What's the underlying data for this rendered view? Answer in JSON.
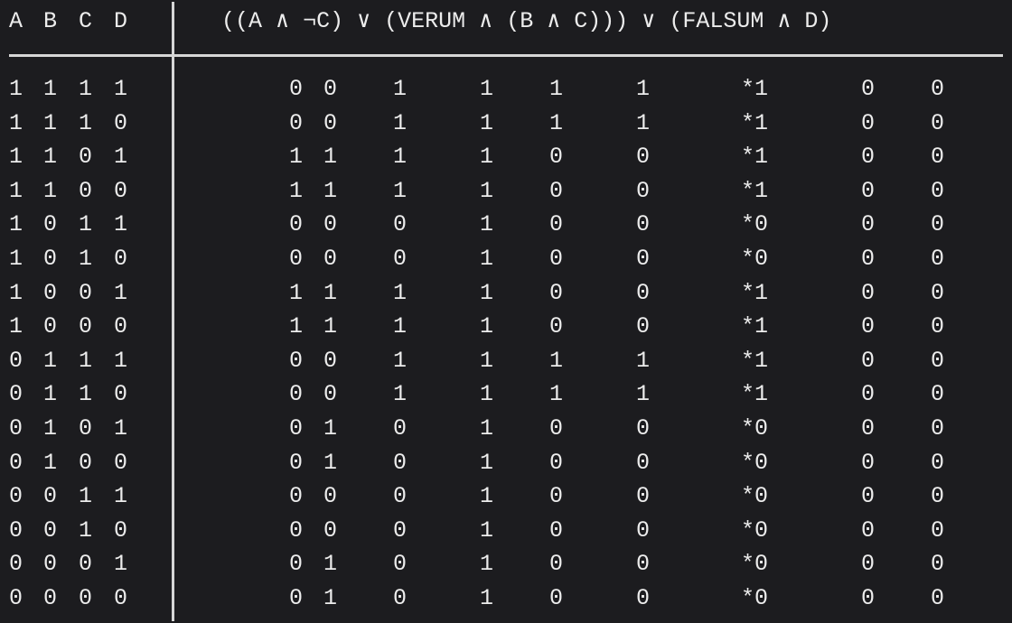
{
  "header": {
    "vars": [
      "A",
      "B",
      "C",
      "D"
    ],
    "expression": "((A ∧ ¬C) ∨ (VERUM ∧ (B ∧ C))) ∨ (FALSUM ∧ D)"
  },
  "rows": [
    {
      "vars": [
        "1",
        "1",
        "1",
        "1"
      ],
      "vals": [
        "0",
        "0",
        "1",
        "1",
        "1",
        "1",
        "*1",
        "0",
        "0"
      ]
    },
    {
      "vars": [
        "1",
        "1",
        "1",
        "0"
      ],
      "vals": [
        "0",
        "0",
        "1",
        "1",
        "1",
        "1",
        "*1",
        "0",
        "0"
      ]
    },
    {
      "vars": [
        "1",
        "1",
        "0",
        "1"
      ],
      "vals": [
        "1",
        "1",
        "1",
        "1",
        "0",
        "0",
        "*1",
        "0",
        "0"
      ]
    },
    {
      "vars": [
        "1",
        "1",
        "0",
        "0"
      ],
      "vals": [
        "1",
        "1",
        "1",
        "1",
        "0",
        "0",
        "*1",
        "0",
        "0"
      ]
    },
    {
      "vars": [
        "1",
        "0",
        "1",
        "1"
      ],
      "vals": [
        "0",
        "0",
        "0",
        "1",
        "0",
        "0",
        "*0",
        "0",
        "0"
      ]
    },
    {
      "vars": [
        "1",
        "0",
        "1",
        "0"
      ],
      "vals": [
        "0",
        "0",
        "0",
        "1",
        "0",
        "0",
        "*0",
        "0",
        "0"
      ]
    },
    {
      "vars": [
        "1",
        "0",
        "0",
        "1"
      ],
      "vals": [
        "1",
        "1",
        "1",
        "1",
        "0",
        "0",
        "*1",
        "0",
        "0"
      ]
    },
    {
      "vars": [
        "1",
        "0",
        "0",
        "0"
      ],
      "vals": [
        "1",
        "1",
        "1",
        "1",
        "0",
        "0",
        "*1",
        "0",
        "0"
      ]
    },
    {
      "vars": [
        "0",
        "1",
        "1",
        "1"
      ],
      "vals": [
        "0",
        "0",
        "1",
        "1",
        "1",
        "1",
        "*1",
        "0",
        "0"
      ]
    },
    {
      "vars": [
        "0",
        "1",
        "1",
        "0"
      ],
      "vals": [
        "0",
        "0",
        "1",
        "1",
        "1",
        "1",
        "*1",
        "0",
        "0"
      ]
    },
    {
      "vars": [
        "0",
        "1",
        "0",
        "1"
      ],
      "vals": [
        "0",
        "1",
        "0",
        "1",
        "0",
        "0",
        "*0",
        "0",
        "0"
      ]
    },
    {
      "vars": [
        "0",
        "1",
        "0",
        "0"
      ],
      "vals": [
        "0",
        "1",
        "0",
        "1",
        "0",
        "0",
        "*0",
        "0",
        "0"
      ]
    },
    {
      "vars": [
        "0",
        "0",
        "1",
        "1"
      ],
      "vals": [
        "0",
        "0",
        "0",
        "1",
        "0",
        "0",
        "*0",
        "0",
        "0"
      ]
    },
    {
      "vars": [
        "0",
        "0",
        "1",
        "0"
      ],
      "vals": [
        "0",
        "0",
        "0",
        "1",
        "0",
        "0",
        "*0",
        "0",
        "0"
      ]
    },
    {
      "vars": [
        "0",
        "0",
        "0",
        "1"
      ],
      "vals": [
        "0",
        "1",
        "0",
        "1",
        "0",
        "0",
        "*0",
        "0",
        "0"
      ]
    },
    {
      "vars": [
        "0",
        "0",
        "0",
        "0"
      ],
      "vals": [
        "0",
        "1",
        "0",
        "1",
        "0",
        "0",
        "*0",
        "0",
        "0"
      ]
    }
  ]
}
